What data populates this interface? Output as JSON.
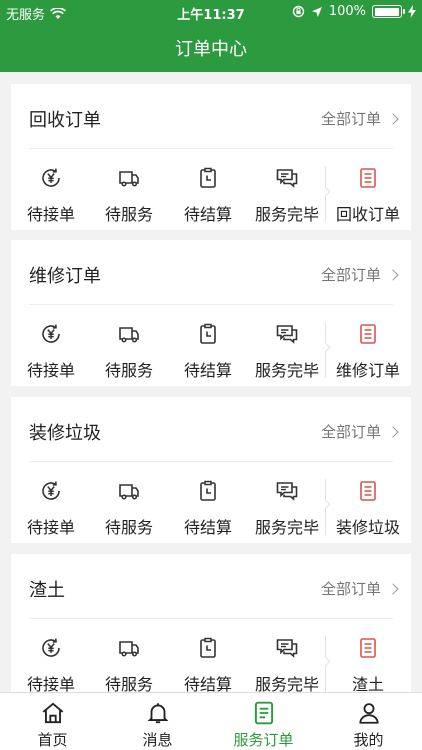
{
  "status_bar": {
    "carrier": "无服务",
    "time": "上午11:37",
    "battery_text": "100%",
    "battery_level": 1.0
  },
  "nav": {
    "title": "订单中心"
  },
  "cards": [
    {
      "title": "回收订单",
      "all_label": "全部订单",
      "items": [
        "待接单",
        "待服务",
        "待结算",
        "服务完毕"
      ],
      "special_label": "回收订单"
    },
    {
      "title": "维修订单",
      "all_label": "全部订单",
      "items": [
        "待接单",
        "待服务",
        "待结算",
        "服务完毕"
      ],
      "special_label": "维修订单"
    },
    {
      "title": "装修垃圾",
      "all_label": "全部订单",
      "items": [
        "待接单",
        "待服务",
        "待结算",
        "服务完毕"
      ],
      "special_label": "装修垃圾"
    },
    {
      "title": "渣土",
      "all_label": "全部订单",
      "items": [
        "待接单",
        "待服务",
        "待结算",
        "服务完毕"
      ],
      "special_label": "渣土"
    }
  ],
  "icons": {
    "items": [
      "yen-refresh-icon",
      "truck-icon",
      "clipboard-clock-icon",
      "chat-bubbles-icon"
    ],
    "special": "document-list-icon"
  },
  "tabs": [
    {
      "label": "首页",
      "icon": "home-icon",
      "active": false
    },
    {
      "label": "消息",
      "icon": "bell-icon",
      "active": false
    },
    {
      "label": "服务订单",
      "icon": "order-list-icon",
      "active": true
    },
    {
      "label": "我的",
      "icon": "user-icon",
      "active": false
    }
  ],
  "colors": {
    "brand_green": "#2c9a3e",
    "accent_red": "#d9534f",
    "background": "#f2f2f2"
  }
}
